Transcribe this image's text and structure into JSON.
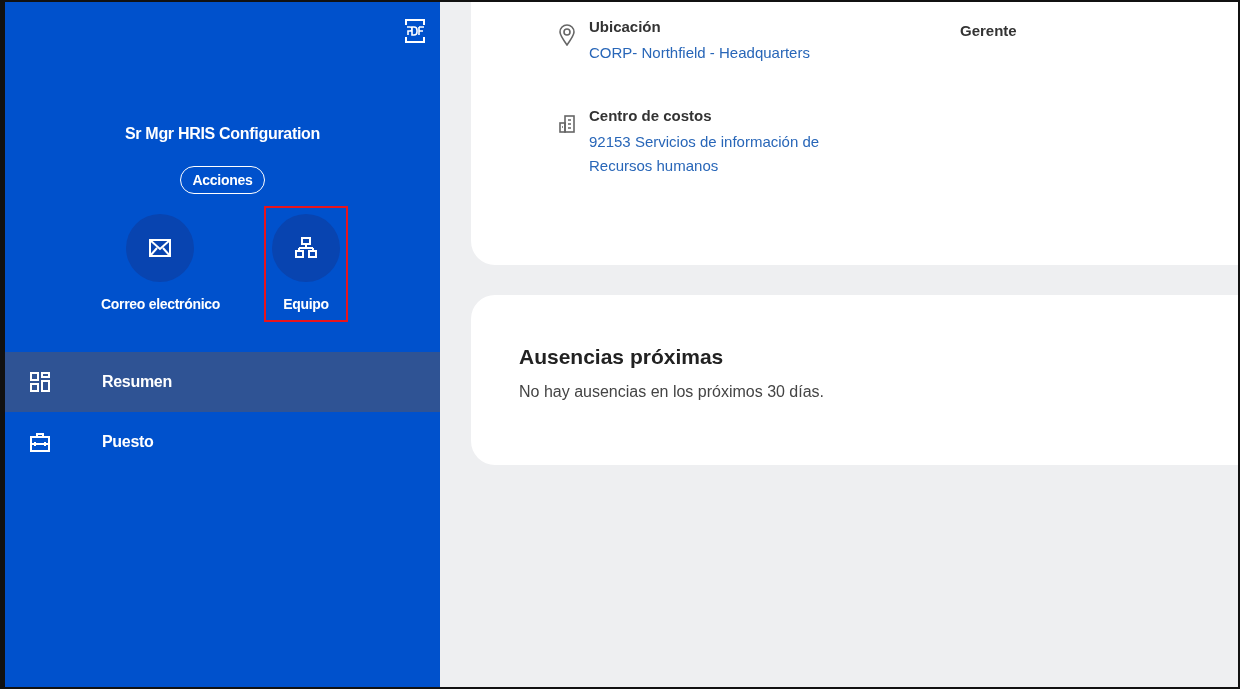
{
  "sidebar": {
    "job_title": "Sr Mgr HRIS Configuration",
    "actions_button": "Acciones",
    "quick_actions": [
      {
        "kind": "email",
        "label": "Correo electrónico",
        "highlighted": false
      },
      {
        "kind": "team",
        "label": "Equipo",
        "highlighted": true
      }
    ],
    "nav_items": [
      {
        "kind": "summary",
        "label": "Resumen",
        "selected": true
      },
      {
        "kind": "job",
        "label": "Puesto",
        "selected": false
      }
    ]
  },
  "details_card": {
    "fields": [
      {
        "kind": "location",
        "label": "Ubicación",
        "value": "CORP- Northfield - Headquarters"
      },
      {
        "kind": "cost_center",
        "label": "Centro de costos",
        "value": "92153 Servicios de información de Recursos humanos"
      }
    ],
    "side_label": "Gerente"
  },
  "absences_card": {
    "title": "Ausencias próximas",
    "message": "No hay ausencias en los próximos 30 días."
  }
}
